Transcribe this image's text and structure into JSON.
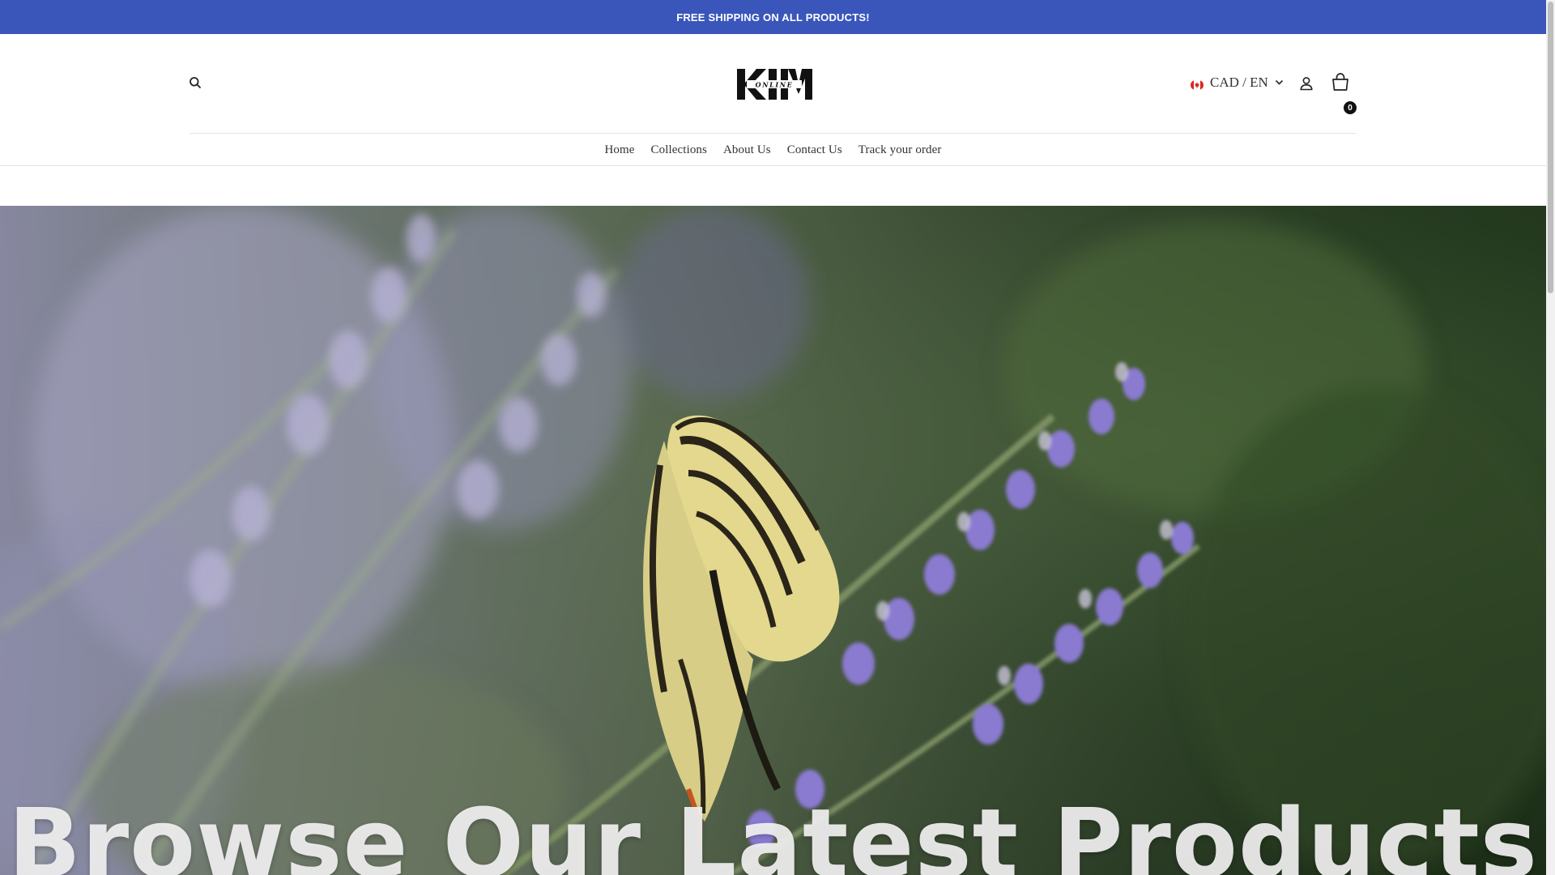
{
  "announcement": {
    "text": "FREE SHIPPING ON ALL PRODUCTS!",
    "background": "#3a56bb"
  },
  "header": {
    "search_icon": "search-icon",
    "logo": {
      "main": "KIM",
      "sub": "ONLINE"
    },
    "locale": {
      "flag_icon": "canada-flag-icon",
      "label": "CAD / EN"
    },
    "account_icon": "user-icon",
    "cart": {
      "icon": "shopping-bag-icon",
      "count": "0"
    }
  },
  "nav": {
    "items": [
      {
        "label": "Home"
      },
      {
        "label": "Collections"
      },
      {
        "label": "About Us"
      },
      {
        "label": "Contact Us"
      },
      {
        "label": "Track your order"
      }
    ]
  },
  "hero": {
    "title": "Browse Our Latest Products",
    "image_subject": "butterfly-on-lavender"
  }
}
